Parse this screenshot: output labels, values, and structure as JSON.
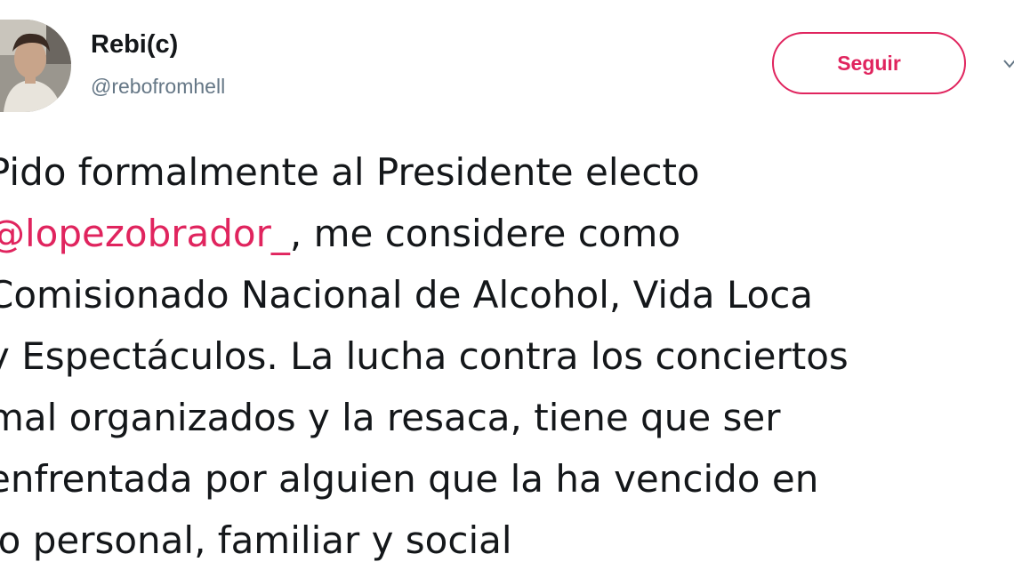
{
  "tweet": {
    "author": {
      "display_name": "Rebi(c)",
      "handle": "@rebofromhell",
      "avatar_icon": "profile-photo"
    },
    "follow_button_label": "Seguir",
    "caret_icon": "chevron-down-icon",
    "text_lines": [
      {
        "before": "Pido formalmente al Presidente electo",
        "mention": "",
        "after": ""
      },
      {
        "before": "",
        "mention": "@lopezobrador_",
        "after": ", me considere como"
      },
      {
        "before": "Comisionado Nacional de Alcohol, Vida Loca",
        "mention": "",
        "after": ""
      },
      {
        "before": "y Espectáculos. La lucha contra los conciertos",
        "mention": "",
        "after": ""
      },
      {
        "before": "mal organizados y la resaca,  tiene que ser",
        "mention": "",
        "after": ""
      },
      {
        "before": "enfrentada por alguien que la ha vencido en",
        "mention": "",
        "after": ""
      },
      {
        "before": "lo personal, familiar y social",
        "mention": "",
        "after": ""
      }
    ]
  },
  "colors": {
    "accent": "#e0245e",
    "text_primary": "#14171a",
    "text_secondary": "#657786",
    "background": "#ffffff"
  }
}
